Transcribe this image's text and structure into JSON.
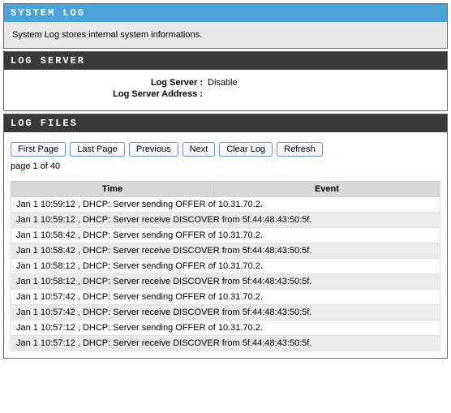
{
  "system_log": {
    "title": "SYSTEM LOG",
    "description": "System Log stores internal system informations."
  },
  "log_server": {
    "title": "LOG SERVER",
    "rows": [
      {
        "label": "Log Server :",
        "value": "Disable"
      },
      {
        "label": "Log Server Address :",
        "value": ""
      }
    ]
  },
  "log_files": {
    "title": "LOG FILES",
    "buttons": {
      "first_page": "First Page",
      "last_page": "Last Page",
      "previous": "Previous",
      "next": "Next",
      "clear_log": "Clear Log",
      "refresh": "Refresh"
    },
    "pager": "page 1 of 40",
    "columns": {
      "time": "Time",
      "event": "Event"
    },
    "rows": [
      "Jan 1 10:59:12 , DHCP: Server sending OFFER of 10.31.70.2.",
      "Jan 1 10:59:12 , DHCP: Server receive DISCOVER from 5f:44:48:43:50:5f.",
      "Jan 1 10:58:42 , DHCP: Server sending OFFER of 10.31.70.2.",
      "Jan 1 10:58:42 , DHCP: Server receive DISCOVER from 5f:44:48:43:50:5f.",
      "Jan 1 10:58:12 , DHCP: Server sending OFFER of 10.31.70.2.",
      "Jan 1 10:58:12 , DHCP: Server receive DISCOVER from 5f:44:48:43:50:5f.",
      "Jan 1 10:57:42 , DHCP: Server sending OFFER of 10.31.70.2.",
      "Jan 1 10:57:42 , DHCP: Server receive DISCOVER from 5f:44:48:43:50:5f.",
      "Jan 1 10:57:12 , DHCP: Server sending OFFER of 10.31.70.2.",
      "Jan 1 10:57:12 , DHCP: Server receive DISCOVER from 5f:44:48:43:50:5f."
    ]
  }
}
